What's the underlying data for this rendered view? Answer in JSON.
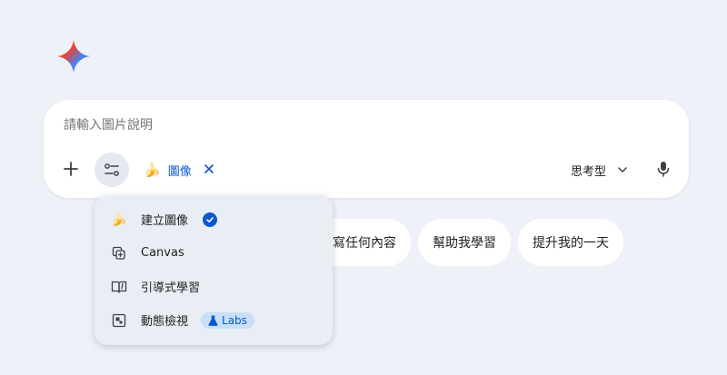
{
  "logo": {
    "icon": "gemini-spark-icon"
  },
  "prompt": {
    "placeholder": "請輸入圖片說明",
    "value": ""
  },
  "toolbar": {
    "add_icon": "plus-icon",
    "tools_icon": "tools-sliders-icon",
    "active_tool": {
      "emoji": "🍌",
      "label": "圖像",
      "remove_icon": "close-icon"
    },
    "model": {
      "label": "思考型",
      "icon": "chevron-down-icon"
    },
    "mic_icon": "mic-icon"
  },
  "suggestions": [
    {
      "label": "寫任何內容"
    },
    {
      "label": "幫助我學習"
    },
    {
      "label": "提升我的一天"
    }
  ],
  "tools_menu": {
    "items": [
      {
        "label": "建立圖像",
        "icon": "banana-icon",
        "selected": true
      },
      {
        "label": "Canvas",
        "icon": "canvas-icon"
      },
      {
        "label": "引導式學習",
        "icon": "guided-learning-icon"
      },
      {
        "label": "動態檢視",
        "icon": "dynamic-view-icon",
        "badge": "Labs"
      }
    ]
  },
  "colors": {
    "background": "#eef1f8",
    "accent": "#0b57d0",
    "menu_bg": "#e9edf4",
    "labs_bg": "#c7e0f8"
  }
}
